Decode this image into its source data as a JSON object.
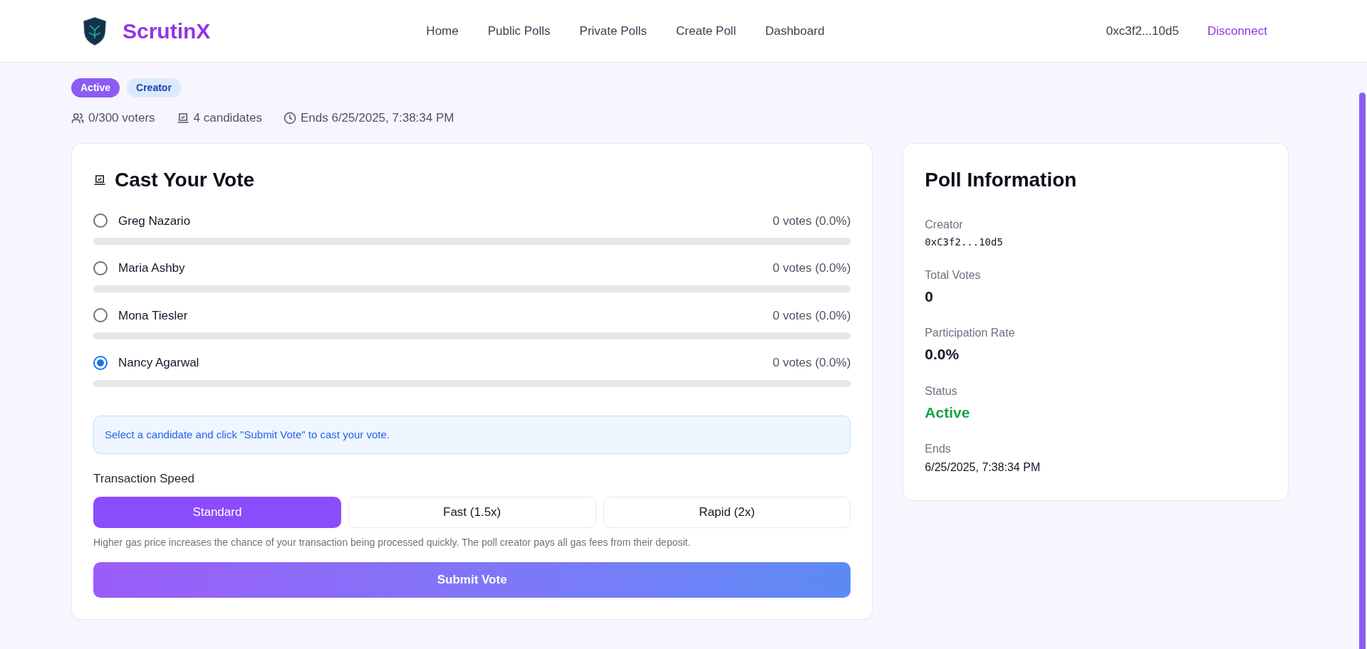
{
  "header": {
    "brand": "ScrutinX",
    "nav": [
      {
        "label": "Home"
      },
      {
        "label": "Public Polls"
      },
      {
        "label": "Private Polls"
      },
      {
        "label": "Create Poll"
      },
      {
        "label": "Dashboard"
      }
    ],
    "wallet": "0xc3f2...10d5",
    "disconnect": "Disconnect"
  },
  "badges": [
    {
      "label": "Active",
      "kind": "status"
    },
    {
      "label": "Creator",
      "kind": "role"
    }
  ],
  "stats": [
    {
      "kind": "voters",
      "text": "0/300 voters"
    },
    {
      "kind": "candidates",
      "text": "4 candidates"
    },
    {
      "kind": "ends",
      "text": "Ends 6/25/2025, 7:38:34 PM"
    }
  ],
  "vote_card": {
    "title": "Cast Your Vote",
    "candidates": [
      {
        "name": "Greg Nazario",
        "votes": "0 votes (0.0%)",
        "selected": false,
        "level": 0
      },
      {
        "name": "Maria Ashby",
        "votes": "0 votes (0.0%)",
        "selected": false,
        "level": 0
      },
      {
        "name": "Mona Tiesler",
        "votes": "0 votes (0.0%)",
        "selected": false,
        "level": 0
      },
      {
        "name": "Nancy Agarwal",
        "votes": "0 votes (0.0%)",
        "selected": true,
        "level": 0
      }
    ],
    "notice": "Select a candidate and click \"Submit Vote\" to cast your vote.",
    "speed_label": "Transaction Speed",
    "speeds": [
      {
        "label": "Standard",
        "selected": true
      },
      {
        "label": "Fast (1.5x)",
        "selected": false
      },
      {
        "label": "Rapid (2x)",
        "selected": false
      }
    ],
    "speed_help": "Higher gas price increases the chance of your transaction being processed quickly. The poll creator pays all gas fees from their deposit.",
    "submit": "Submit Vote"
  },
  "info_card": {
    "title": "Poll Information",
    "fields": [
      {
        "label": "Creator",
        "value": "0xC3f2...10d5",
        "kind": "address"
      },
      {
        "label": "Total Votes",
        "value": "0",
        "kind": "number"
      },
      {
        "label": "Participation Rate",
        "value": "0.0%",
        "kind": "number"
      },
      {
        "label": "Status",
        "value": "Active",
        "kind": "status"
      },
      {
        "label": "Ends",
        "value": "6/25/2025, 7:38:34 PM",
        "kind": "text"
      }
    ]
  }
}
